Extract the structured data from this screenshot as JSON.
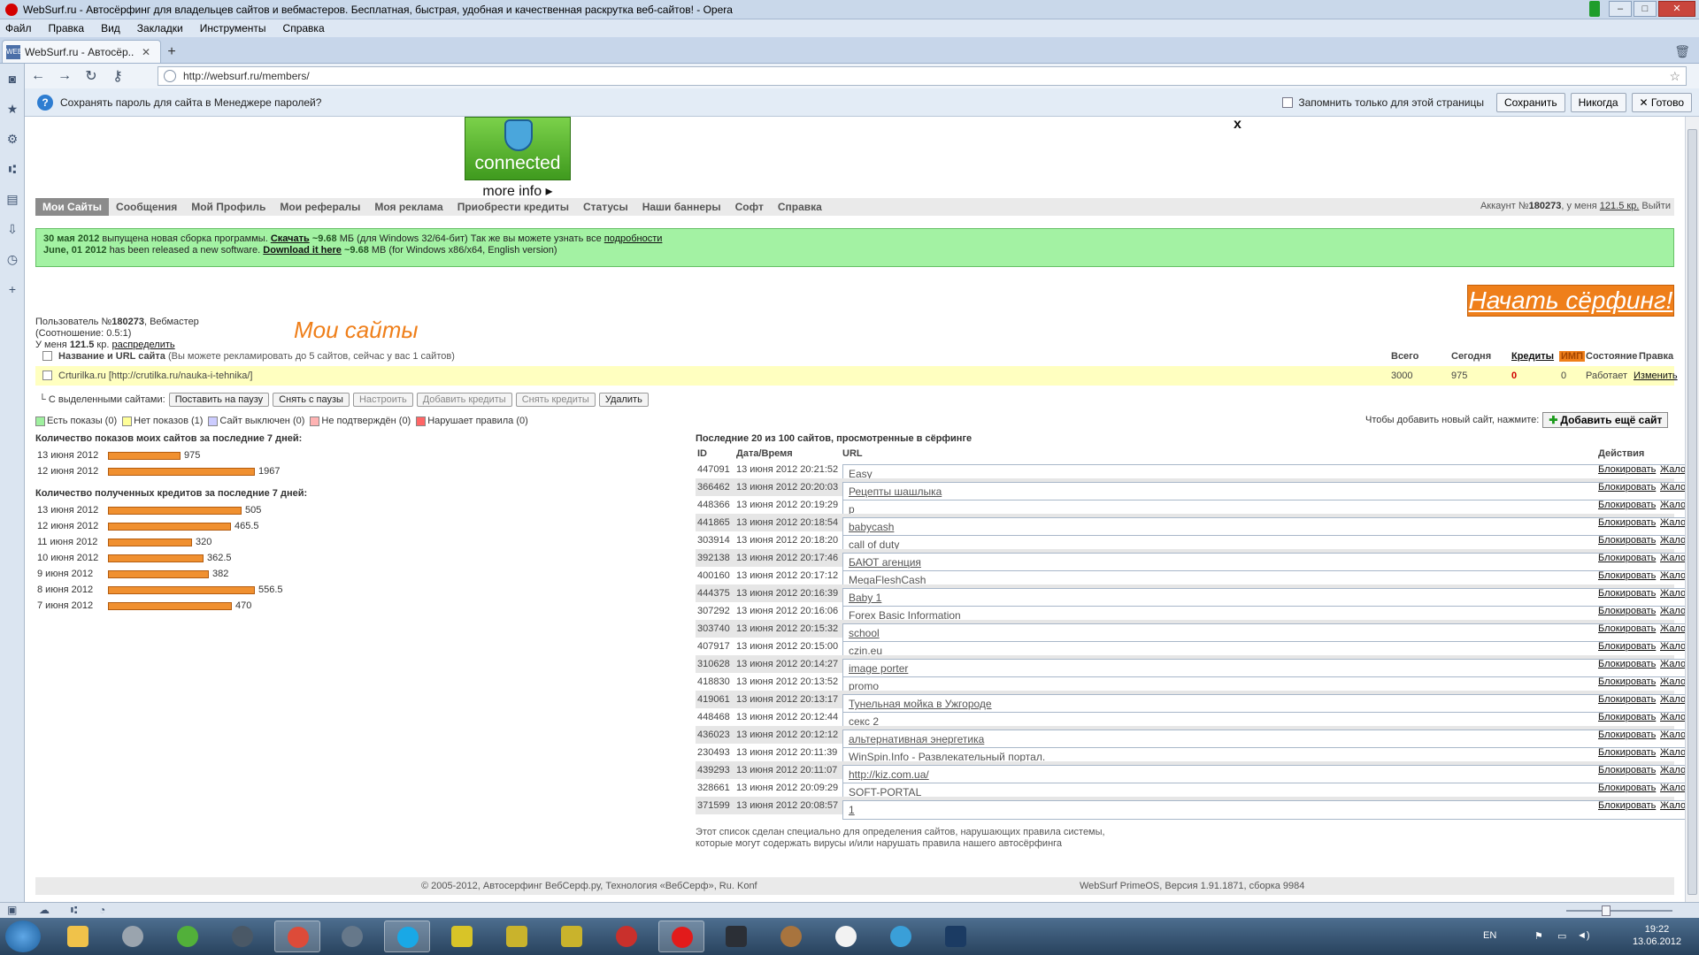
{
  "window": {
    "title": "WebSurf.ru - Автосёрфинг для владельцев сайтов и вебмастеров. Бесплатная, быстрая, удобная и качественная раскрутка веб-сайтов! - Opera"
  },
  "menu": [
    "Файл",
    "Правка",
    "Вид",
    "Закладки",
    "Инструменты",
    "Справка"
  ],
  "tab": {
    "title": "WebSurf.ru - Автосёр...",
    "favicon_text": "WEB"
  },
  "address": {
    "url": "http://websurf.ru/members/"
  },
  "password_bar": {
    "message": "Сохранять пароль для сайта в Менеджере паролей?",
    "checkbox_label": "Запомнить только для этой страницы",
    "save": "Сохранить",
    "never": "Никогда",
    "done": "✕ Готово"
  },
  "hotspot": {
    "connected": "connected",
    "more": "more info ▸",
    "close": "x"
  },
  "nav": {
    "items": [
      "Мои Сайты",
      "Сообщения",
      "Мой Профиль",
      "Мои рефералы",
      "Моя реклама",
      "Приобрести кредиты",
      "Статусы",
      "Наши баннеры",
      "Софт",
      "Справка"
    ],
    "account_prefix": "Аккаунт №",
    "account_id": "180273",
    "balance_prefix": ", у меня ",
    "balance": "121.5 кр.",
    "logout": "Выйти"
  },
  "notice": {
    "line1_date": "30 мая 2012",
    "line1_text": " выпущена новая сборка программы. ",
    "line1_link": "Скачать",
    "line1_size": " ~9.68",
    "line1_rest": " МБ (для Windows 32/64-бит) Так же вы можете узнать все ",
    "line1_more": "подробности",
    "line2_date": "June, 01 2012",
    "line2_text": " has been released a new software. ",
    "line2_link": "Download it here",
    "line2_size": " ~9.68",
    "line2_rest": " MB (for Windows x86/x64, English version)"
  },
  "start_surfing": "Начать сёрфинг!",
  "user": {
    "line1_prefix": "Пользователь №",
    "id": "180273",
    "role": ", Вебмастер",
    "ratio": "(Соотношение: 0.5:1)",
    "balance_prefix": "У меня ",
    "balance": "121.5",
    "balance_suffix": " кр. ",
    "distribute": "распределить"
  },
  "my_sites_title": "Мои сайты",
  "sites_table": {
    "header_name": "Название и URL сайта",
    "header_note": " (Вы можете рекламировать до 5 сайтов, сейчас у вас 1 сайтов)",
    "col_total": "Всего",
    "col_today": "Сегодня",
    "col_credits": "Кредиты",
    "col_imp": "ИМП",
    "col_state": "Состояние",
    "col_edit": "Правка",
    "row": {
      "name": "Crturilka.ru [http://crutilka.ru/nauka-i-tehnika/]",
      "total": "3000",
      "today": "975",
      "credits": "0",
      "imp": "0",
      "state": "Работает",
      "edit": "Изменить"
    }
  },
  "bulk": {
    "label": "└ С выделенными сайтами:",
    "pause": "Поставить на паузу",
    "unpause": "Снять с паузы",
    "configure": "Настроить",
    "add_credits": "Добавить кредиты",
    "remove_credits": "Снять кредиты",
    "delete": "Удалить"
  },
  "legend": [
    {
      "label": "Есть показы (0)",
      "color": "#9ff09f"
    },
    {
      "label": "Нет показов (1)",
      "color": "#ffff99"
    },
    {
      "label": "Сайт выключен (0)",
      "color": "#ccccff"
    },
    {
      "label": "Не подтверждён (0)",
      "color": "#ffb3b3"
    },
    {
      "label": "Нарушает правила (0)",
      "color": "#ff6666"
    }
  ],
  "add_site": {
    "label": "Чтобы добавить новый сайт, нажмите:",
    "button": "Добавить ещё сайт"
  },
  "views_stats": {
    "title": "Количество показов моих сайтов за последние 7 дней:",
    "rows": [
      {
        "date": "13 июня 2012",
        "value": 975
      },
      {
        "date": "12 июня 2012",
        "value": 1967
      }
    ]
  },
  "credits_stats": {
    "title": "Количество полученных кредитов за последние 7 дней:",
    "rows": [
      {
        "date": "13 июня 2012",
        "value": 505
      },
      {
        "date": "12 июня 2012",
        "value": 465.5
      },
      {
        "date": "11 июня 2012",
        "value": 320
      },
      {
        "date": "10 июня 2012",
        "value": 362.5
      },
      {
        "date": "9 июня 2012",
        "value": 382
      },
      {
        "date": "8 июня 2012",
        "value": 556.5
      },
      {
        "date": "7 июня 2012",
        "value": 470
      }
    ]
  },
  "recent": {
    "title": "Последние 20 из 100 сайтов, просмотренные в сёрфинге",
    "col_id": "ID",
    "col_date": "Дата/Время",
    "col_url": "URL",
    "col_actions": "Действия",
    "block": "Блокировать",
    "complain": "Жалоба",
    "rows": [
      {
        "id": "447091",
        "date": "13 июня 2012 20:21:52",
        "url": "Easy"
      },
      {
        "id": "366462",
        "date": "13 июня 2012 20:20:03",
        "url": "Рецепты шашлыка"
      },
      {
        "id": "448366",
        "date": "13 июня 2012 20:19:29",
        "url": "p"
      },
      {
        "id": "441865",
        "date": "13 июня 2012 20:18:54",
        "url": "babycash"
      },
      {
        "id": "303914",
        "date": "13 июня 2012 20:18:20",
        "url": "call of duty"
      },
      {
        "id": "392138",
        "date": "13 июня 2012 20:17:46",
        "url": "БАЮТ агенция"
      },
      {
        "id": "400160",
        "date": "13 июня 2012 20:17:12",
        "url": "MegaFleshCash"
      },
      {
        "id": "444375",
        "date": "13 июня 2012 20:16:39",
        "url": "Baby 1"
      },
      {
        "id": "307292",
        "date": "13 июня 2012 20:16:06",
        "url": "Forex Basic Information"
      },
      {
        "id": "303740",
        "date": "13 июня 2012 20:15:32",
        "url": "school"
      },
      {
        "id": "407917",
        "date": "13 июня 2012 20:15:00",
        "url": "czin.eu"
      },
      {
        "id": "310628",
        "date": "13 июня 2012 20:14:27",
        "url": "image porter"
      },
      {
        "id": "418830",
        "date": "13 июня 2012 20:13:52",
        "url": "promo"
      },
      {
        "id": "419061",
        "date": "13 июня 2012 20:13:17",
        "url": "Тунельная мойка в Ужгороде"
      },
      {
        "id": "448468",
        "date": "13 июня 2012 20:12:44",
        "url": "секс 2"
      },
      {
        "id": "436023",
        "date": "13 июня 2012 20:12:12",
        "url": "альтернативная энергетика"
      },
      {
        "id": "230493",
        "date": "13 июня 2012 20:11:39",
        "url": "WinSpin.Info - Развлекательный портал."
      },
      {
        "id": "439293",
        "date": "13 июня 2012 20:11:07",
        "url": "http://kiz.com.ua/"
      },
      {
        "id": "328661",
        "date": "13 июня 2012 20:09:29",
        "url": "SOFT-PORTAL"
      },
      {
        "id": "371599",
        "date": "13 июня 2012 20:08:57",
        "url": "1"
      }
    ],
    "footnote1": "Этот список сделан специально для определения сайтов, нарушающих правила системы,",
    "footnote2": "которые могут содержать вирусы и/или нарушать правила нашего автосёрфинга"
  },
  "footer": {
    "left": "© 2005-2012, Автосерфинг ВебСерф.ру, Технология «ВебСерф», Ru. Konf",
    "right": "WebSurf PrimeOS, Версия 1.91.1871, сборка 9984"
  },
  "taskbar": {
    "lang": "EN",
    "time": "19:22",
    "date": "13.06.2012"
  }
}
